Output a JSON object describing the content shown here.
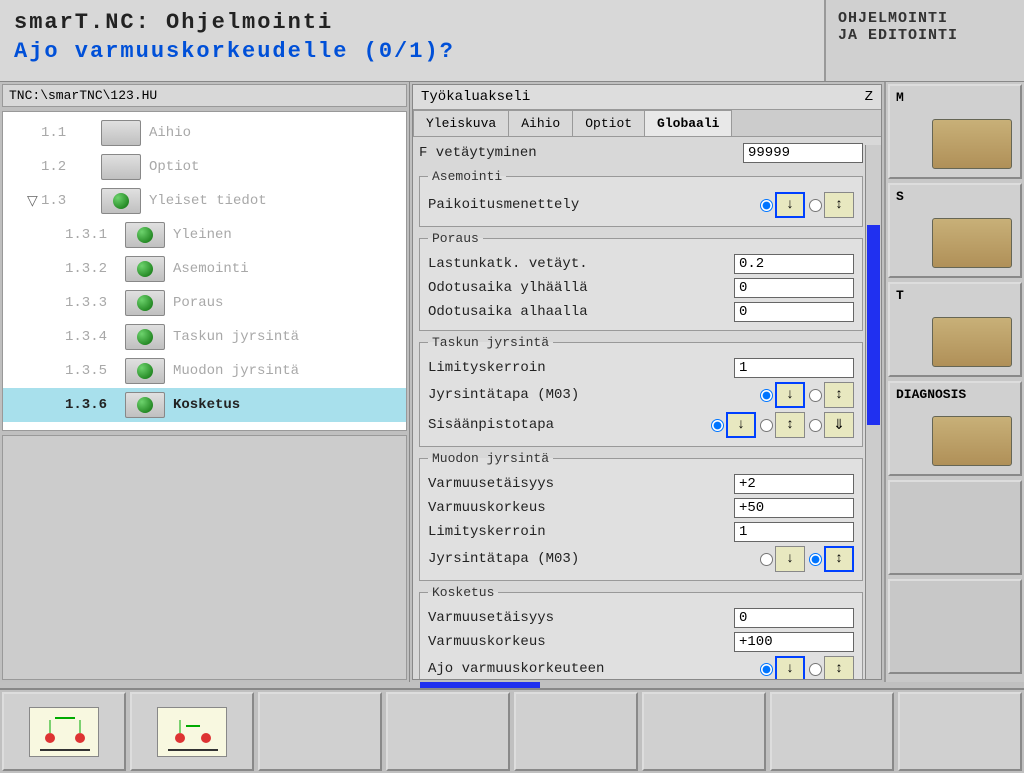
{
  "header": {
    "title": "smarT.NC: Ohjelmointi",
    "prompt": "Ajo varmuuskorkeudelle (0/1)?",
    "mode_line1": "OHJELMOINTI",
    "mode_line2": "JA EDITOINTI"
  },
  "path": "TNC:\\smarTNC\\123.HU",
  "tree": [
    {
      "num": "1.1",
      "label": "Aihio",
      "level": 1,
      "icon": "box"
    },
    {
      "num": "1.2",
      "label": "Optiot",
      "level": 1,
      "icon": "list"
    },
    {
      "num": "1.3",
      "label": "Yleiset tiedot",
      "level": 1,
      "icon": "globe",
      "expanded": true
    },
    {
      "num": "1.3.1",
      "label": "Yleinen",
      "level": 2,
      "icon": "globe"
    },
    {
      "num": "1.3.2",
      "label": "Asemointi",
      "level": 2,
      "icon": "globe"
    },
    {
      "num": "1.3.3",
      "label": "Poraus",
      "level": 2,
      "icon": "globe"
    },
    {
      "num": "1.3.4",
      "label": "Taskun jyrsintä",
      "level": 2,
      "icon": "globe"
    },
    {
      "num": "1.3.5",
      "label": "Muodon jyrsintä",
      "level": 2,
      "icon": "globe"
    },
    {
      "num": "1.3.6",
      "label": "Kosketus",
      "level": 2,
      "icon": "globe",
      "active": true
    }
  ],
  "params_header": {
    "title": "Työkaluakseli",
    "axis": "Z"
  },
  "tabs": [
    "Yleiskuva",
    "Aihio",
    "Optiot",
    "Globaali"
  ],
  "tab_active": 3,
  "top_row": {
    "label": "F vetäytyminen",
    "value": "99999"
  },
  "groups": [
    {
      "legend": "Asemointi",
      "rows": [
        {
          "label": "Paikoitusmenettely",
          "type": "radio",
          "sel": 0,
          "count": 2
        }
      ]
    },
    {
      "legend": "Poraus",
      "rows": [
        {
          "label": "Lastunkatk. vetäyt.",
          "type": "input",
          "value": "0.2"
        },
        {
          "label": "Odotusaika ylhäällä",
          "type": "input",
          "value": "0"
        },
        {
          "label": "Odotusaika alhaalla",
          "type": "input",
          "value": "0"
        }
      ]
    },
    {
      "legend": "Taskun jyrsintä",
      "rows": [
        {
          "label": "Limityskerroin",
          "type": "input",
          "value": "1"
        },
        {
          "label": "Jyrsintätapa (M03)",
          "type": "radio",
          "sel": 0,
          "count": 2
        },
        {
          "label": "Sisäänpistotapa",
          "type": "radio",
          "sel": 0,
          "count": 3
        }
      ]
    },
    {
      "legend": "Muodon jyrsintä",
      "rows": [
        {
          "label": "Varmuusetäisyys",
          "type": "input",
          "value": "+2"
        },
        {
          "label": "Varmuuskorkeus",
          "type": "input",
          "value": "+50"
        },
        {
          "label": "Limityskerroin",
          "type": "input",
          "value": "1"
        },
        {
          "label": "Jyrsintätapa (M03)",
          "type": "radio",
          "sel": 1,
          "count": 2
        }
      ]
    },
    {
      "legend": "Kosketus",
      "rows": [
        {
          "label": "Varmuusetäisyys",
          "type": "input",
          "value": "0"
        },
        {
          "label": "Varmuuskorkeus",
          "type": "input",
          "value": "+100"
        },
        {
          "label": "Ajo varmuuskorkeuteen",
          "type": "radio",
          "sel": 0,
          "count": 2
        }
      ]
    }
  ],
  "side_buttons": [
    {
      "letter": "M"
    },
    {
      "letter": "S"
    },
    {
      "letter": "T"
    },
    {
      "letter": "DIAGNOSIS"
    },
    {
      "letter": ""
    },
    {
      "letter": ""
    }
  ]
}
